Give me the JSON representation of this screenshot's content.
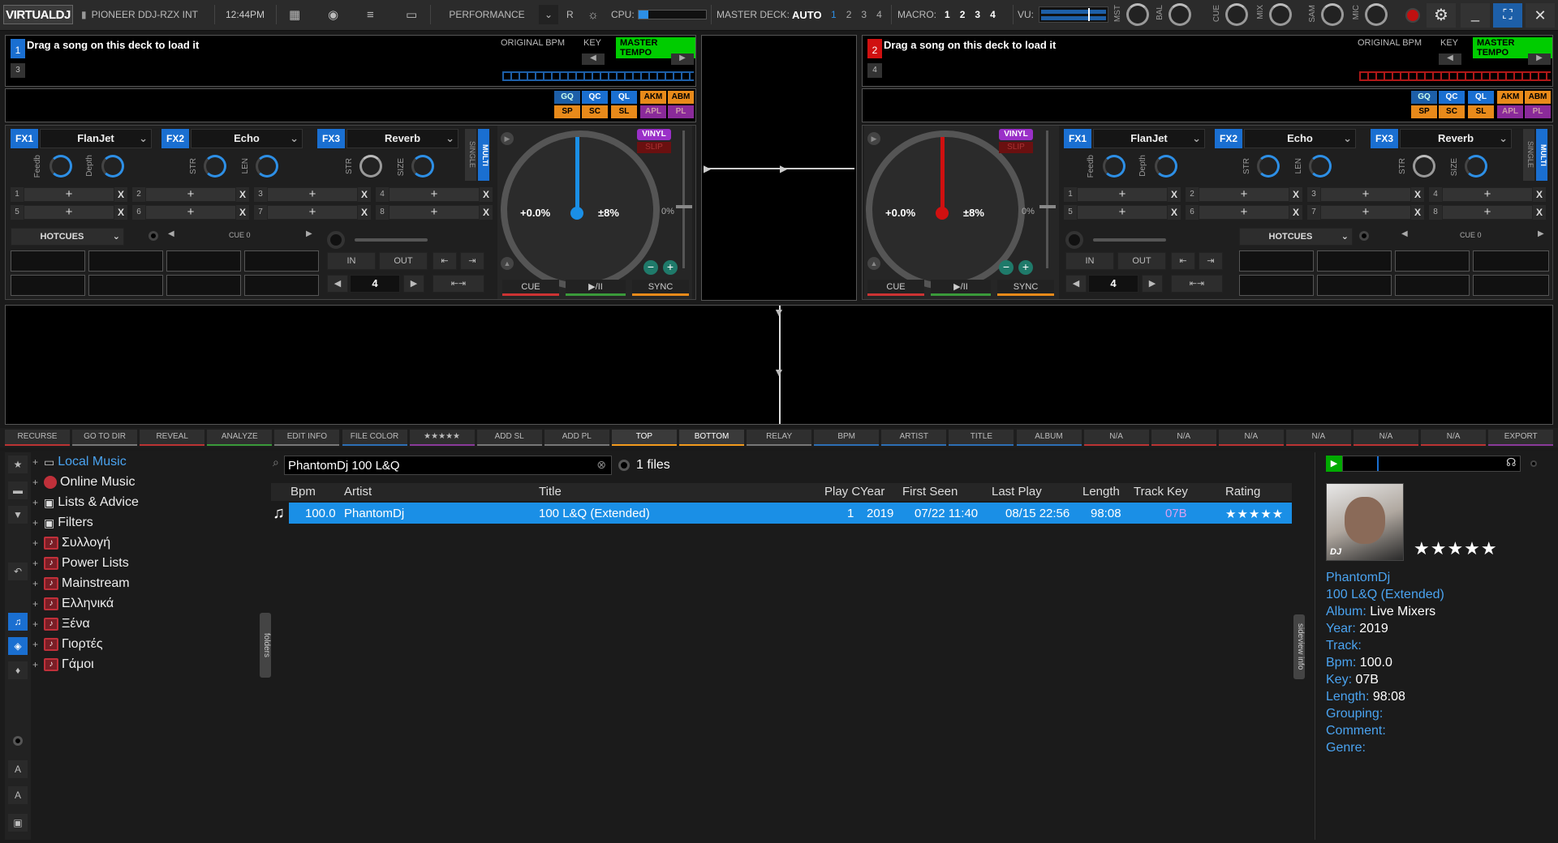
{
  "topbar": {
    "logo": "VIRTUALDJ",
    "controller": "PIONEER DDJ-RZX INT",
    "time": "12:44PM",
    "layout": "PERFORMANCE",
    "r": "R",
    "cpu": "CPU:",
    "master_deck": "MASTER DECK:",
    "auto": "AUTO",
    "master_nums": [
      "1",
      "2",
      "3",
      "4"
    ],
    "macro": "MACRO:",
    "macro_nums": [
      "1",
      "2",
      "3",
      "4"
    ],
    "vu": "VU:",
    "knob_labels": [
      "MST",
      "BAL",
      "CUE",
      "MIX",
      "SAM",
      "MIC"
    ]
  },
  "deck1": {
    "num": "1",
    "sub": "3",
    "prompt": "Drag a song on this deck to load it",
    "obpm": "ORIGINAL BPM",
    "key": "KEY",
    "mt": "MASTER TEMPO",
    "pitch": "+0.0%",
    "range": "±8%",
    "zero": "0%",
    "vinyl": "VINYL",
    "slip": "SLIP",
    "cue": "CUE",
    "play": "▶/II",
    "sync": "SYNC",
    "fx": [
      {
        "n": "FX1",
        "name": "FlanJet",
        "k1": "Feedb",
        "k2": "Depth"
      },
      {
        "n": "FX2",
        "name": "Echo",
        "k1": "STR",
        "k2": "LEN"
      },
      {
        "n": "FX3",
        "name": "Reverb",
        "k1": "STR",
        "k2": "SIZE"
      }
    ],
    "single": "SINGLE",
    "multi": "MULTI",
    "hotcues": "HOTCUES",
    "cue0": "CUE 0",
    "in": "IN",
    "out": "OUT",
    "loop": "4"
  },
  "deck2": {
    "num": "2",
    "sub": "4",
    "prompt": "Drag a song on this deck to load it",
    "obpm": "ORIGINAL BPM",
    "key": "KEY",
    "mt": "MASTER TEMPO",
    "pitch": "+0.0%",
    "range": "±8%",
    "zero": "0%",
    "vinyl": "VINYL",
    "slip": "SLIP",
    "cue": "CUE",
    "play": "▶/II",
    "sync": "SYNC",
    "fx": [
      {
        "n": "FX1",
        "name": "FlanJet",
        "k1": "Feedb",
        "k2": "Depth"
      },
      {
        "n": "FX2",
        "name": "Echo",
        "k1": "STR",
        "k2": "LEN"
      },
      {
        "n": "FX3",
        "name": "Reverb",
        "k1": "STR",
        "k2": "SIZE"
      }
    ],
    "single": "SINGLE",
    "multi": "MULTI",
    "hotcues": "HOTCUES",
    "cue0": "CUE 0",
    "in": "IN",
    "out": "OUT",
    "loop": "4"
  },
  "padmodes": [
    "GQ",
    "QC",
    "QL",
    "AKM",
    "ABM",
    "SP",
    "SC",
    "SL",
    "APL",
    "PL"
  ],
  "toolbar": [
    "RECURSE",
    "GO TO DIR",
    "REVEAL",
    "ANALYZE",
    "EDIT INFO",
    "FILE COLOR",
    "★★★★★",
    "ADD SL",
    "ADD PL",
    "TOP",
    "BOTTOM",
    "RELAY",
    "BPM",
    "ARTIST",
    "TITLE",
    "ALBUM",
    "N/A",
    "N/A",
    "N/A",
    "N/A",
    "N/A",
    "N/A",
    "EXPORT"
  ],
  "sidebar": [
    {
      "label": "Local Music",
      "color": "#4aa3f0"
    },
    {
      "label": "Online Music"
    },
    {
      "label": "Lists & Advice"
    },
    {
      "label": "Filters"
    },
    {
      "label": "Συλλογή"
    },
    {
      "label": "Power Lists"
    },
    {
      "label": "Mainstream"
    },
    {
      "label": "Ελληνικά"
    },
    {
      "label": "Ξένα"
    },
    {
      "label": "Γιορτές"
    },
    {
      "label": "Γάμοι"
    }
  ],
  "search": {
    "value": "PhantomDj 100 L&Q",
    "files": "1 files"
  },
  "columns": [
    "Bpm",
    "Artist",
    "Title",
    "Play C",
    "Year",
    "First Seen",
    "Last Play",
    "Length",
    "Track",
    "Key",
    "Rating"
  ],
  "rows": [
    {
      "bpm": "100.0",
      "artist": "PhantomDj",
      "title": "100 L&Q (Extended)",
      "play": "1",
      "year": "2019",
      "first": "07/22 11:40",
      "last": "08/15 22:56",
      "length": "98:08",
      "track": "",
      "key": "07B",
      "rating": "★★★★★"
    }
  ],
  "tabs": {
    "folders": "folders",
    "sideview": "sideview",
    "info": "info"
  },
  "info": {
    "stars": "★★★★★",
    "artist": "PhantomDj",
    "title": "100 L&Q (Extended)",
    "album_l": "Album:",
    "album": "Live Mixers",
    "year_l": "Year:",
    "year": "2019",
    "track_l": "Track:",
    "bpm_l": "Bpm:",
    "bpm": "100.0",
    "key_l": "Key:",
    "key": "07B",
    "length_l": "Length:",
    "length": "98:08",
    "grouping_l": "Grouping:",
    "comment_l": "Comment:",
    "genre_l": "Genre:",
    "cover_text": "DJ"
  }
}
